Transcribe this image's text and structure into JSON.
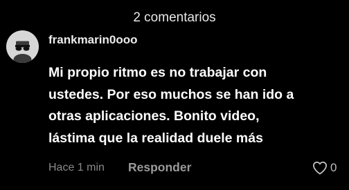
{
  "header": {
    "title": "2 comentarios"
  },
  "comment": {
    "username": "frankmarin0ooo",
    "avatar_icon": "sunglasses-face-icon",
    "text_lines": [
      "Mi propio ritmo es no trabajar con",
      "ustedes. Por eso muchos se han ido a",
      "otras aplicaciones. Bonito video,",
      "lástima que la realidad duele más"
    ],
    "timestamp": "Hace 1 min",
    "reply_label": "Responder",
    "like_icon": "heart-outline-icon",
    "like_count": "0"
  },
  "colors": {
    "background": "#000000",
    "text_primary": "#ffffff",
    "text_secondary": "#8a8a8a",
    "avatar_bg": "#d7d7d7"
  }
}
